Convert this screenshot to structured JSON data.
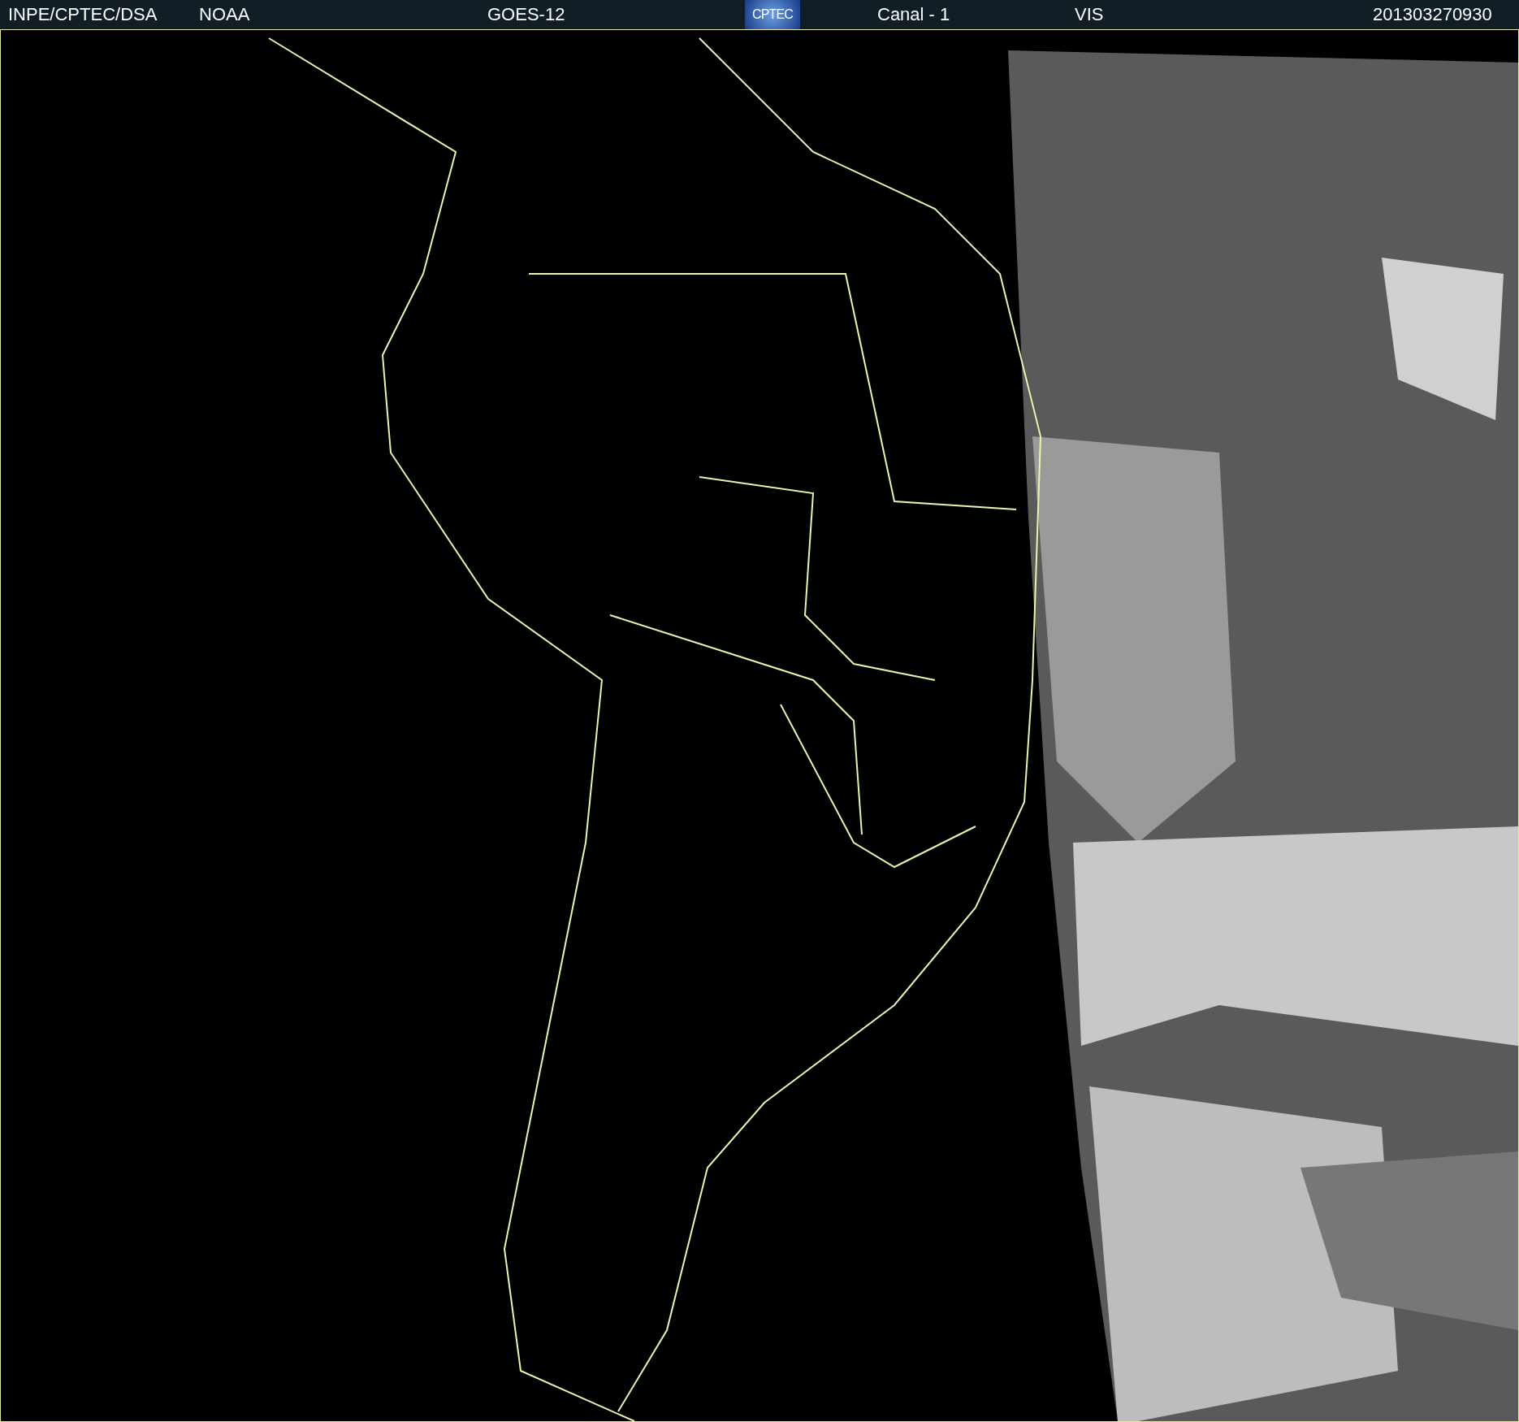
{
  "header": {
    "items": [
      {
        "kind": "text",
        "text": "INPE/CPTEC/DSA"
      },
      {
        "kind": "text",
        "text": "NOAA"
      },
      {
        "kind": "text",
        "text": "GOES-12"
      },
      {
        "kind": "logo",
        "text": "CPTEC"
      },
      {
        "kind": "text",
        "text": "Canal - 1"
      },
      {
        "kind": "text",
        "text": "VIS"
      },
      {
        "kind": "text",
        "text": "201303270930"
      }
    ]
  }
}
